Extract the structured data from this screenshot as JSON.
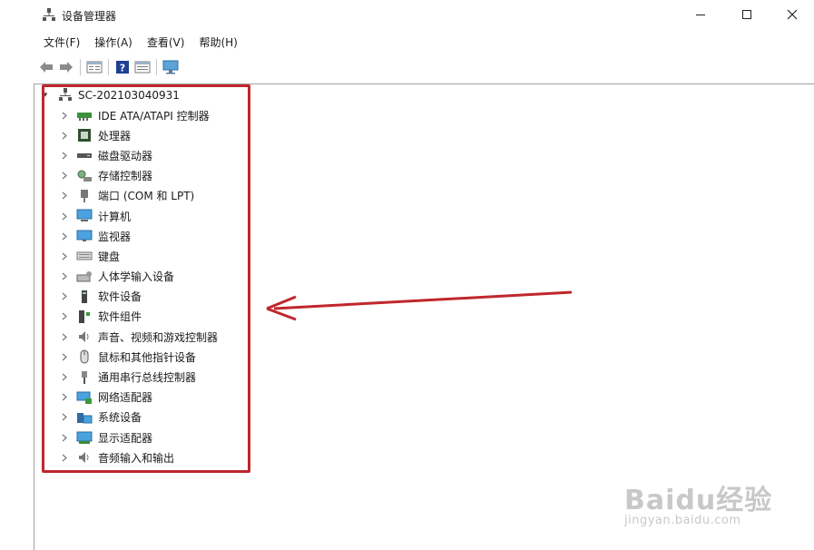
{
  "window": {
    "title": "设备管理器",
    "controls": {
      "minimize": "minimize",
      "maximize": "maximize",
      "close": "close"
    }
  },
  "menubar": {
    "items": [
      {
        "label": "文件(F)"
      },
      {
        "label": "操作(A)"
      },
      {
        "label": "查看(V)"
      },
      {
        "label": "帮助(H)"
      }
    ]
  },
  "toolbar": {
    "buttons": [
      "back-icon",
      "forward-icon",
      "properties-icon",
      "help-icon",
      "view-icon",
      "monitor-icon"
    ]
  },
  "tree": {
    "root": {
      "label": "SC-202103040931",
      "icon": "computer-network-icon"
    },
    "items": [
      {
        "label": "IDE ATA/ATAPI 控制器",
        "icon": "ide-controller-icon"
      },
      {
        "label": "处理器",
        "icon": "processor-icon"
      },
      {
        "label": "磁盘驱动器",
        "icon": "disk-drive-icon"
      },
      {
        "label": "存储控制器",
        "icon": "storage-controller-icon"
      },
      {
        "label": "端口 (COM 和 LPT)",
        "icon": "port-icon"
      },
      {
        "label": "计算机",
        "icon": "computer-icon"
      },
      {
        "label": "监视器",
        "icon": "monitor-icon"
      },
      {
        "label": "键盘",
        "icon": "keyboard-icon"
      },
      {
        "label": "人体学输入设备",
        "icon": "hid-icon"
      },
      {
        "label": "软件设备",
        "icon": "software-device-icon"
      },
      {
        "label": "软件组件",
        "icon": "software-component-icon"
      },
      {
        "label": "声音、视频和游戏控制器",
        "icon": "sound-icon"
      },
      {
        "label": "鼠标和其他指针设备",
        "icon": "mouse-icon"
      },
      {
        "label": "通用串行总线控制器",
        "icon": "usb-icon"
      },
      {
        "label": "网络适配器",
        "icon": "network-adapter-icon"
      },
      {
        "label": "系统设备",
        "icon": "system-device-icon"
      },
      {
        "label": "显示适配器",
        "icon": "display-adapter-icon"
      },
      {
        "label": "音频输入和输出",
        "icon": "audio-io-icon"
      }
    ]
  },
  "annotation": {
    "color": "#c0272d"
  },
  "watermark": {
    "logo": "Baidu经验",
    "url": "jingyan.baidu.com"
  }
}
